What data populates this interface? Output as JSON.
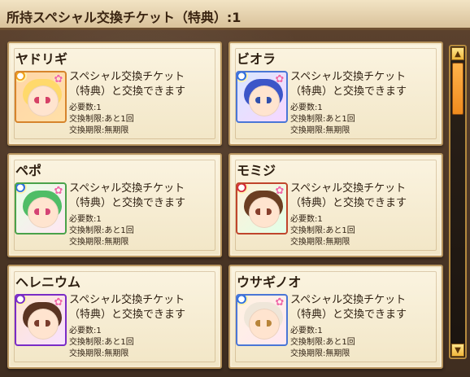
{
  "header": {
    "title": "所持スペシャル交換チケット（特典）:1"
  },
  "cards": [
    {
      "name": "ヤドリギ",
      "desc_line1": "スペシャル交換チケット",
      "desc_line2": "（特典）と交換できます",
      "req": "必要数:1",
      "limit": "交換制限:あと1回",
      "expiry": "交換期限:無期限",
      "element_icon": "element-orb-icon",
      "element_color": "#f2a21a"
    },
    {
      "name": "ビオラ",
      "desc_line1": "スペシャル交換チケット",
      "desc_line2": "（特典）と交換できます",
      "req": "必要数:1",
      "limit": "交換制限:あと1回",
      "expiry": "交換期限:無期限",
      "element_icon": "element-orb-icon",
      "element_color": "#2d6fe0"
    },
    {
      "name": "ペポ",
      "desc_line1": "スペシャル交換チケット",
      "desc_line2": "（特典）と交換できます",
      "req": "必要数:1",
      "limit": "交換制限:あと1回",
      "expiry": "交換期限:無期限",
      "element_icon": "element-orb-icon",
      "element_color": "#2d6fe0"
    },
    {
      "name": "モミジ",
      "desc_line1": "スペシャル交換チケット",
      "desc_line2": "（特典）と交換できます",
      "req": "必要数:1",
      "limit": "交換制限:あと1回",
      "expiry": "交換期限:無期限",
      "element_icon": "element-orb-icon",
      "element_color": "#d6283a"
    },
    {
      "name": "ヘレニウム",
      "desc_line1": "スペシャル交換チケット",
      "desc_line2": "（特典）と交換できます",
      "req": "必要数:1",
      "limit": "交換制限:あと1回",
      "expiry": "交換期限:無期限",
      "element_icon": "element-orb-icon",
      "element_color": "#7a2cc6"
    },
    {
      "name": "ウサギノオ",
      "desc_line1": "スペシャル交換チケット",
      "desc_line2": "（特典）と交換できます",
      "req": "必要数:1",
      "limit": "交換制限:あと1回",
      "expiry": "交換期限:無期限",
      "element_icon": "element-orb-icon",
      "element_color": "#2d6fe0"
    }
  ],
  "scrollbar": {
    "up_icon": "up-arrow-icon",
    "down_icon": "down-arrow-icon"
  }
}
